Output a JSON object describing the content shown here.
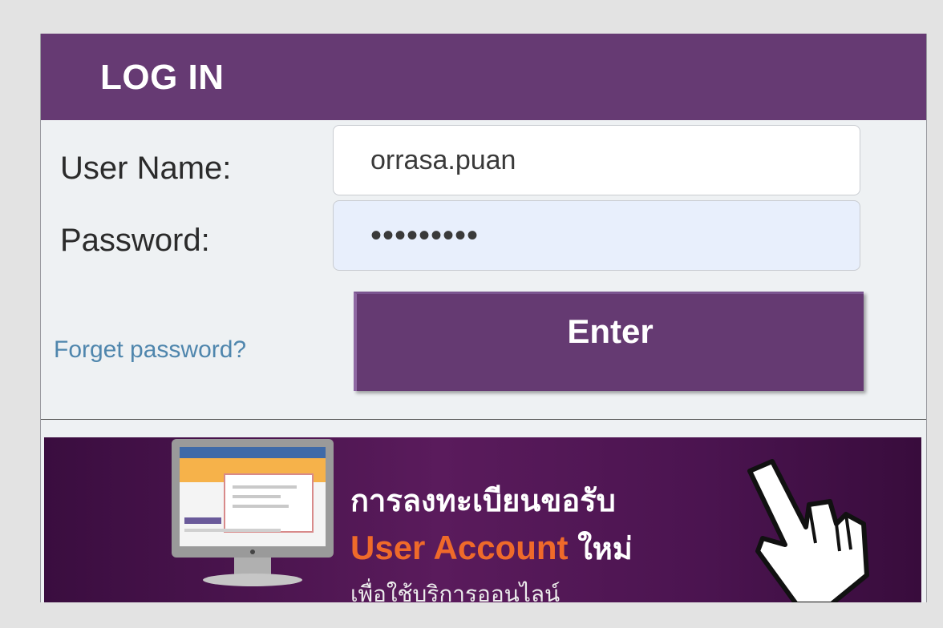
{
  "login": {
    "title": "LOG IN",
    "username_label": "User Name:",
    "username_value": "orrasa.puan",
    "password_label": "Password:",
    "password_value": "•••••••••",
    "forgot_link": "Forget password?",
    "enter_button": "Enter"
  },
  "banner": {
    "line1": "การลงทะเบียนขอรับ",
    "line2_highlight": "User Account",
    "line2_suffix": "ใหม่",
    "line3": "เพื่อใช้บริการออนไลน์",
    "highlight_color": "#ef6a2a",
    "icons": [
      "monitor-icon",
      "pointer-hand-icon"
    ]
  },
  "colors": {
    "brand_purple": "#663a73",
    "panel_bg": "#eef1f3",
    "link_blue": "#4f86ad"
  }
}
